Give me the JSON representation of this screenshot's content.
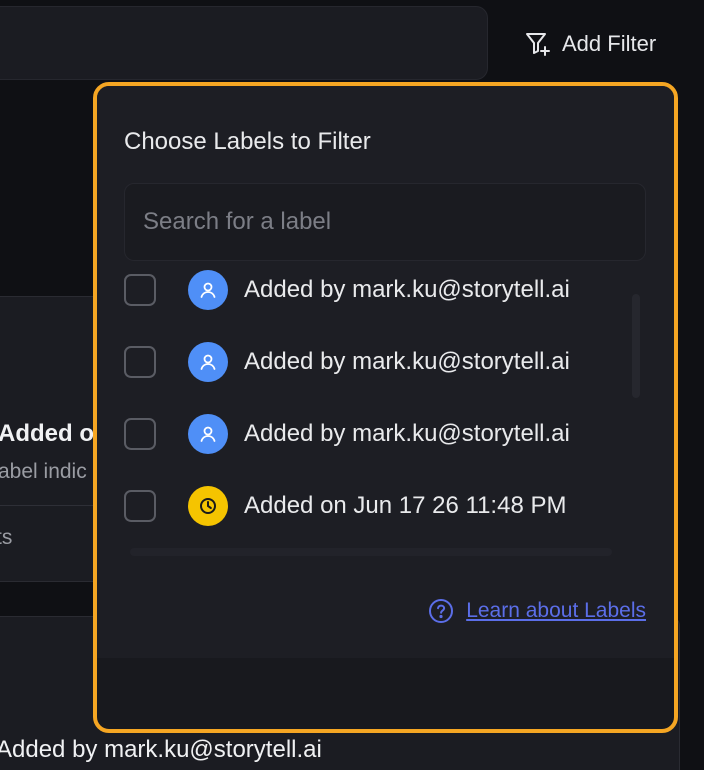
{
  "toolbar": {
    "add_filter_label": "Add Filter"
  },
  "background": {
    "card_title_fragment": "Added o",
    "card_sub_fragment": "abel indic",
    "card_meta_fragment": "ts",
    "bottom_item_label": "Added by mark.ku@storytell.ai"
  },
  "popover": {
    "title": "Choose Labels to Filter",
    "search_placeholder": "Search for a label",
    "labels": [
      {
        "text": "Added by mark.ku@storytell.ai",
        "icon": "user-icon",
        "checked": false
      },
      {
        "text": "Added by mark.ku@storytell.ai",
        "icon": "user-icon",
        "checked": false
      },
      {
        "text": "Added by mark.ku@storytell.ai",
        "icon": "user-icon",
        "checked": false
      },
      {
        "text": "Added on Jun 17 26 11:48 PM",
        "icon": "clock-icon",
        "checked": false
      }
    ],
    "learn_link": "Learn about Labels"
  },
  "colors": {
    "highlight_border": "#f5a623",
    "user_avatar": "#4f8ff7",
    "clock_avatar": "#f5c400",
    "link": "#5b6ee8"
  }
}
